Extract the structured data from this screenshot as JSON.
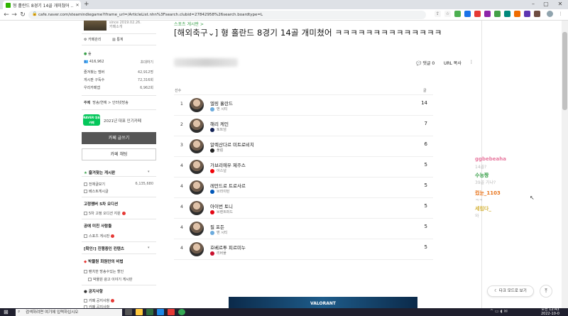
{
  "browser": {
    "tab_title": "형 홀란드 8경기 14골 개미쳤어 ...",
    "url": "cafe.naver.com/steamindiegame?iframe_url=/ArticleList.nhn%3Fsearch.clubid=27842958%26search.boardtype=L"
  },
  "sidebar": {
    "since": "since 2019.02.26.",
    "cafe_story": "카페소개",
    "manage": "카페관리",
    "stats": "통계",
    "level_label": "숲",
    "members": "416,962",
    "invite": "초대하기",
    "stats_rows": [
      {
        "label": "즐겨찾는 멤버",
        "value": "42,912명"
      },
      {
        "label": "게시판 구독수",
        "value": "72,316회"
      },
      {
        "label": "우리카페앱",
        "value": "6,962회"
      }
    ],
    "topics_label": "주제",
    "topics_value": "방송/연예 > 인터넷방송",
    "naver_badge": "NAVER 대표카페",
    "popular": "2021년 대표 인기카페",
    "write_button": "카페 글쓰기",
    "chat_button": "카페 채팅",
    "favorite_boards": "즐겨찾는 게시판",
    "board_all": "전체글보기",
    "board_all_count": "6,135,680",
    "board_best": "베스트게시글",
    "section1": "고정멤버 5차 오디션",
    "item1": "5차 고정 오디션 지원",
    "section2": "공에 미친 사람들",
    "item2": "스포츠 게시판",
    "section3": "[확인!] 진행중인 컨텐츠",
    "section4": "박물원 회원만의 비법",
    "item4a": "팬치한 방송수있는 할인",
    "item4b": "박물원 광고 이야기 게시판",
    "section5": "공지사항",
    "item5a": "카페 공지사항",
    "item5b": "카페 공지사항"
  },
  "article": {
    "breadcrumb": "스포츠 게시판 >",
    "category": "[해외축구⌄]",
    "title": "형 홀란드 8경기 14골 개미쳤어 ㅋㅋㅋㅋㅋㅋㅋㅋㅋㅋㅋㅋㅋㅋ",
    "comments": "댓글 0",
    "copy_url": "URL 복사",
    "col_player": "선수",
    "col_goals": "골",
    "players": [
      {
        "rank": "1",
        "name": "엘링 홀란드",
        "team": "맨 시티",
        "goals": "14",
        "team_color": "#6cabdd"
      },
      {
        "rank": "2",
        "name": "해리 케인",
        "team": "토트넘",
        "goals": "7",
        "team_color": "#132257"
      },
      {
        "rank": "3",
        "name": "알렉산다르 미트로비치",
        "team": "풀럼",
        "goals": "6",
        "team_color": "#222222"
      },
      {
        "rank": "4",
        "name": "가브리에우 제주스",
        "team": "아스널",
        "goals": "5",
        "team_color": "#ef0107"
      },
      {
        "rank": "4",
        "name": "레안드로 트로사르",
        "team": "브라이턴",
        "goals": "5",
        "team_color": "#0057b8"
      },
      {
        "rank": "4",
        "name": "아이번 토니",
        "team": "브렌트퍼드",
        "goals": "5",
        "team_color": "#e30613"
      },
      {
        "rank": "4",
        "name": "필 포든",
        "team": "맨 시티",
        "goals": "5",
        "team_color": "#6cabdd"
      },
      {
        "rank": "4",
        "name": "호베르투 피르미누",
        "team": "리버풀",
        "goals": "5",
        "team_color": "#c8102e"
      }
    ],
    "banner": "VALORANT"
  },
  "chat": [
    {
      "user": "ggbebeaha",
      "msg": "14골?",
      "color": "#e87aa0"
    },
    {
      "user": "수능짱",
      "msg": "39골 가냐?",
      "color": "#3aa04a"
    },
    {
      "user": "컸눈_1103",
      "msg": "ㅋㅋ",
      "color": "#e8731a"
    },
    {
      "user": "세립다_",
      "msg": "와",
      "color": "#d4b23a"
    }
  ],
  "dark_mode": "다크 모드로 보기",
  "taskbar": {
    "search": "검색하려면 여기에 입력하십시오",
    "time": "오전 12:43",
    "date": "2022-10-0"
  }
}
